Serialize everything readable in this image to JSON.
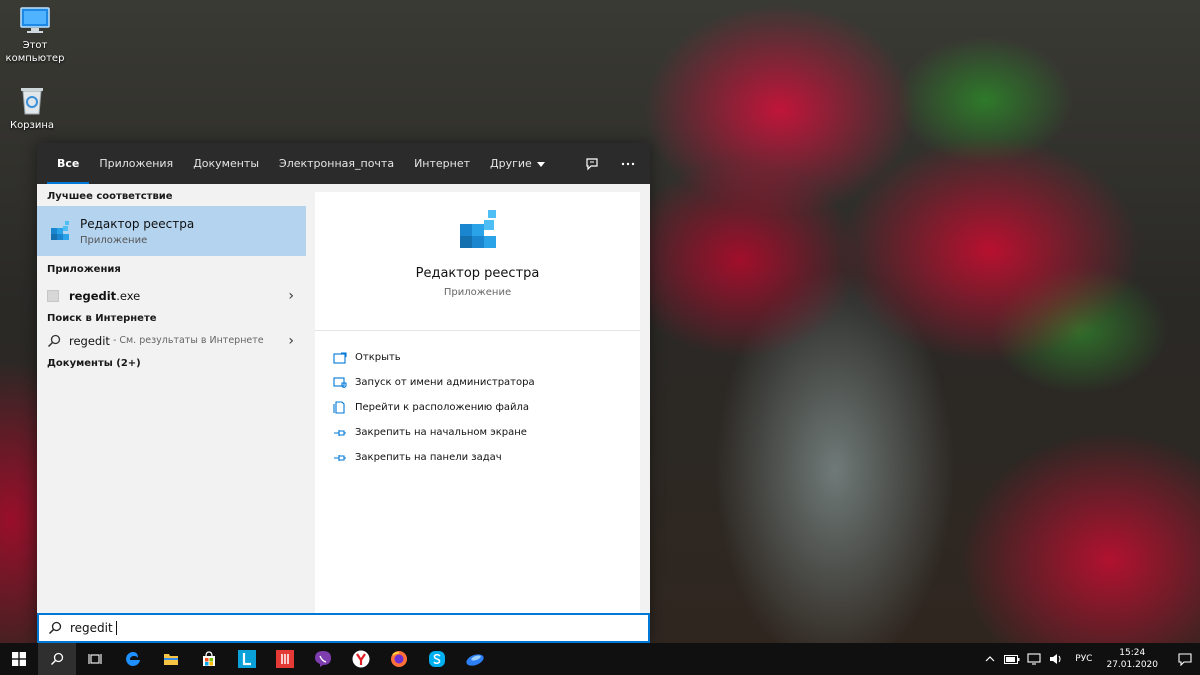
{
  "desktop": {
    "icons": [
      {
        "label": "Этот компьютер"
      },
      {
        "label": "Корзина"
      }
    ]
  },
  "search_panel": {
    "filters": [
      "Все",
      "Приложения",
      "Документы",
      "Электронная_почта",
      "Интернет",
      "Другие"
    ],
    "active_filter": "Все",
    "best_match": {
      "section_title": "Лучшее соответствие",
      "name": "Редактор реестра",
      "type": "Приложение"
    },
    "apps": {
      "section_title": "Приложения",
      "item_bold": "regedit",
      "item_rest": ".exe"
    },
    "web": {
      "section_title": "Поиск в Интернете",
      "query": "regedit",
      "suffix": "- См. результаты в Интернете"
    },
    "documents": {
      "section_title": "Документы (2+)"
    },
    "preview": {
      "name": "Редактор реестра",
      "type": "Приложение",
      "actions": [
        {
          "label": "Открыть",
          "icon": "open-icon"
        },
        {
          "label": "Запуск от имени администратора",
          "icon": "shield-icon"
        },
        {
          "label": "Перейти к расположению файла",
          "icon": "file-location-icon"
        },
        {
          "label": "Закрепить на начальном экране",
          "icon": "pin-icon"
        },
        {
          "label": "Закрепить на панели задач",
          "icon": "pin-icon"
        }
      ]
    },
    "search_box": {
      "value": "regedit"
    }
  },
  "taskbar": {
    "apps": [
      "start-icon",
      "search-icon",
      "task-view-icon",
      "edge-icon",
      "file-explorer-icon",
      "store-icon",
      "l-app-icon",
      "red-app-icon",
      "viber-icon",
      "yandex-icon",
      "firefox-icon",
      "skype-icon",
      "blue-app-icon"
    ],
    "tray": {
      "language": "РУС",
      "time": "15:24",
      "date": "27.01.2020"
    }
  },
  "colors": {
    "accent": "#0078d7",
    "selection": "#b3d3ee",
    "panel_bg": "#f2f2f2",
    "filter_bar_bg": "#2b2b2b",
    "taskbar_bg": "#101010"
  }
}
